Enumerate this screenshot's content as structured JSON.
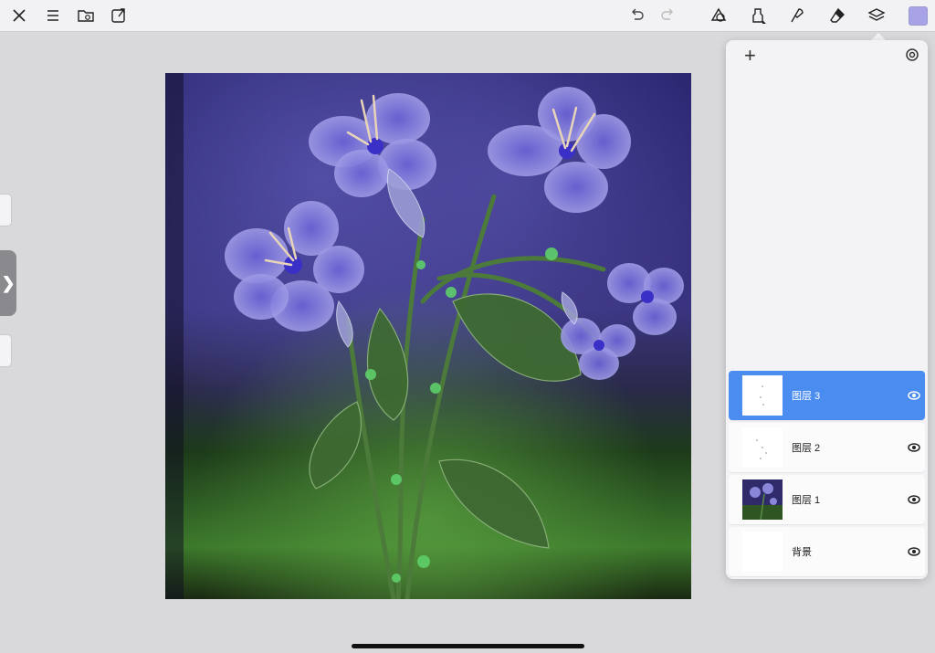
{
  "toolbar": {
    "left_icons": [
      "close-icon",
      "menu-icon",
      "folder-icon",
      "export-icon"
    ],
    "right_icons": [
      "undo-icon",
      "redo-icon",
      "shape-icon",
      "brush-icon",
      "smudge-icon",
      "eraser-icon",
      "layers-icon"
    ],
    "color_value": "#a8a2e6"
  },
  "layers": [
    {
      "name": "图层 3",
      "selected": true
    },
    {
      "name": "图层 2",
      "selected": false
    },
    {
      "name": "图层 1",
      "selected": false
    },
    {
      "name": "背景",
      "selected": false
    }
  ],
  "colors": {
    "accent": "#4a8cf0",
    "canvas_sky": "#3a3480",
    "canvas_ground": "#2f5a22",
    "flower": "#8a86d8"
  }
}
